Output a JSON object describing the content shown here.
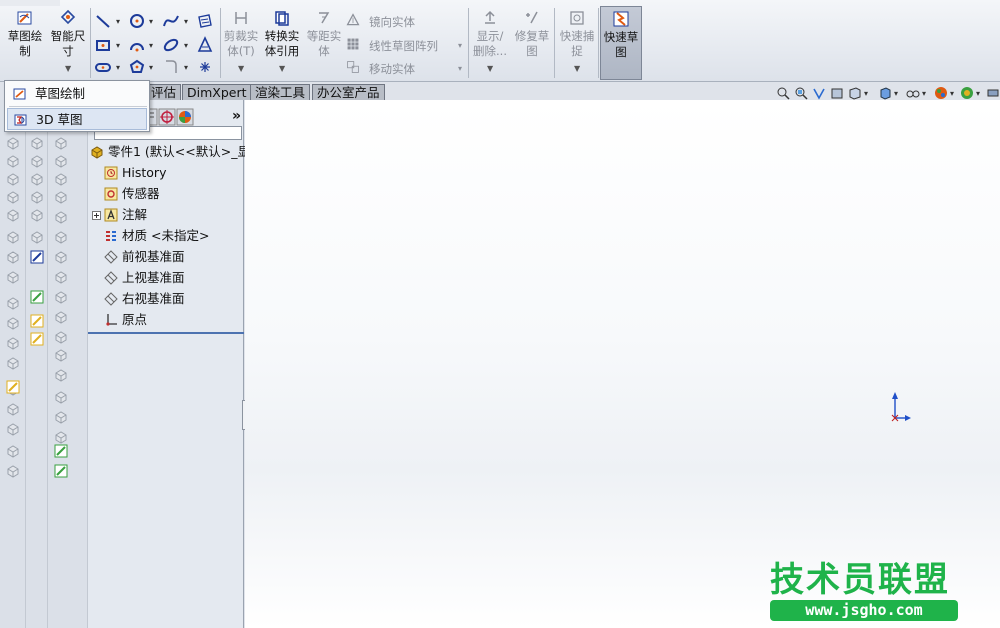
{
  "ribbon": {
    "sketch_btn": "草图绘\n制",
    "smart_dim_btn": "智能尺\n寸",
    "trim_btn": "剪裁实\n体(T)",
    "convert_btn": "转换实\n体引用",
    "offset_btn": "等距实\n体",
    "mirror_label": "镜向实体",
    "linear_pattern_label": "线性草图阵列",
    "move_label": "移动实体",
    "show_delete_btn": "显示/\n删除...",
    "repair_btn": "修复草\n图",
    "quick_snap_btn": "快速捕\n捉",
    "rapid_sketch_btn": "快速草\n图"
  },
  "tabs": [
    "评估",
    "DimXpert",
    "渲染工具",
    "办公室产品"
  ],
  "menu": {
    "items": [
      {
        "label": "草图绘制",
        "icon": "sketch-icon"
      },
      {
        "label": "3D 草图",
        "icon": "3d-sketch-icon"
      }
    ]
  },
  "feature_tree": {
    "expand_label": "»",
    "root": "零件1 (默认<<默认>_显示",
    "items": [
      {
        "label": "History",
        "icon": "history-icon"
      },
      {
        "label": "传感器",
        "icon": "sensor-icon"
      },
      {
        "label": "注解",
        "icon": "annotation-icon"
      },
      {
        "label": "材质 <未指定>",
        "icon": "material-icon"
      },
      {
        "label": "前视基准面",
        "icon": "plane-icon"
      },
      {
        "label": "上视基准面",
        "icon": "plane-icon"
      },
      {
        "label": "右视基准面",
        "icon": "plane-icon"
      },
      {
        "label": "原点",
        "icon": "origin-icon"
      }
    ]
  },
  "watermark": {
    "title": "技术员联盟",
    "url": "www.jsgho.com"
  },
  "colors": {
    "accent_blue": "#1f4fc8",
    "watermark_green": "#1fb34a"
  }
}
